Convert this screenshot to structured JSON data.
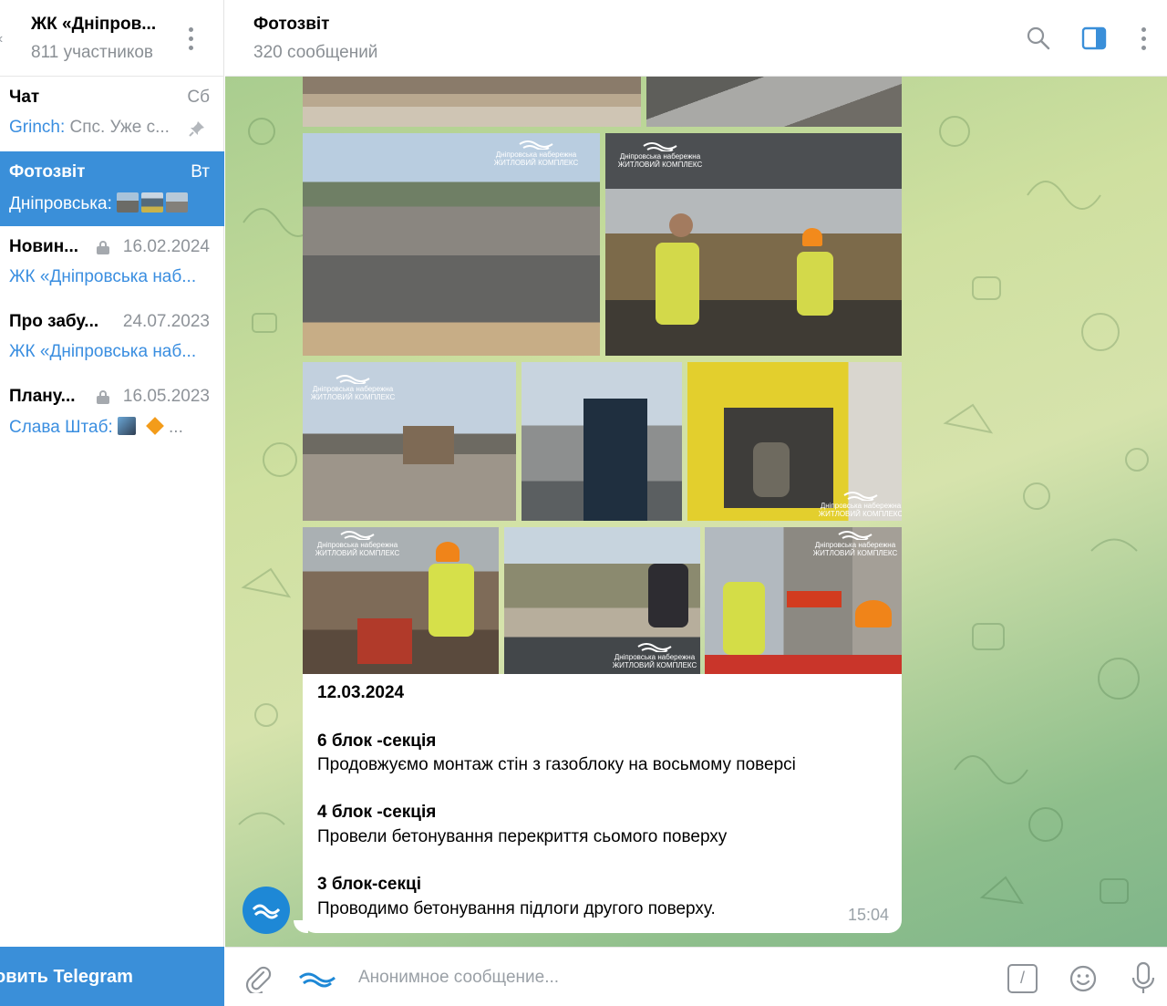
{
  "sidebar": {
    "back_glyph": "‹",
    "group_title": "ЖК «Дніпров...",
    "members": "811 участников",
    "topics": [
      {
        "name": "Чат",
        "date": "Сб",
        "sender": "Grinch:",
        "preview": " Спс. Уже с...",
        "pinned": true,
        "locked": false
      },
      {
        "name": "Фотозвіт",
        "date": "Вт",
        "sender": "Дніпровська:",
        "preview": "",
        "active": true,
        "locked": false
      },
      {
        "name": "Новин...",
        "date": "16.02.2024",
        "sender": "",
        "preview": "ЖК «Дніпровська наб...",
        "locked": true
      },
      {
        "name": "Про забу...",
        "date": "24.07.2023",
        "sender": "",
        "preview": "ЖК «Дніпровська наб...",
        "locked": false
      },
      {
        "name": "Плану...",
        "date": "16.05.2023",
        "sender": "Слава Штаб:",
        "preview": "...",
        "locked": true
      }
    ],
    "update_label": "овить Telegram"
  },
  "header": {
    "title": "Фотозвіт",
    "subtitle": "320 сообщений",
    "icons": [
      "search-icon",
      "side-panel-icon",
      "more-vertical-icon"
    ]
  },
  "album": {
    "watermark_line1": "Дніпровська набережна",
    "watermark_line2": "ЖИТЛОВИЙ КОМПЛЕКС",
    "photo_count": 10
  },
  "message": {
    "date": "12.03.2024",
    "sections": [
      {
        "title": "6 блок -секція",
        "text": "Продовжуємо   монтаж стін з газоблоку на восьмому поверсі"
      },
      {
        "title": "4 блок -секція",
        "text": "Провели бетонування перекриття  сьомого поверху"
      },
      {
        "title": "3 блок-секці",
        "text": "Проводимо бетонування підлоги  другого поверху."
      }
    ],
    "time": "15:04"
  },
  "composer": {
    "placeholder": "Анонимное сообщение...",
    "command_glyph": "/"
  },
  "colors": {
    "accent": "#3a8fd9",
    "link": "#3a8ee0",
    "muted": "#8e9399"
  }
}
